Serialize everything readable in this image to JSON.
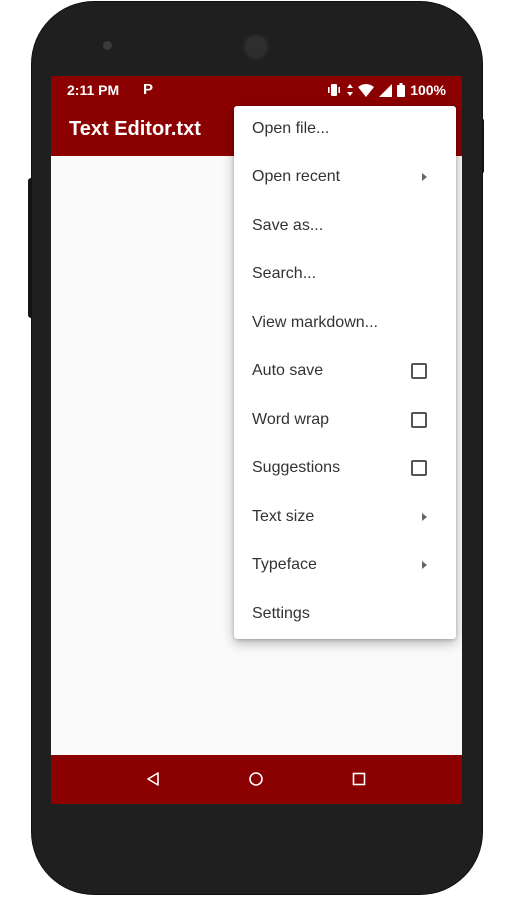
{
  "status_bar": {
    "time": "2:11 PM",
    "notification_glyph": "P",
    "battery": "100%",
    "icons": [
      "vibrate-icon",
      "data-arrows-icon",
      "wifi-icon",
      "cell-signal-icon",
      "battery-icon"
    ]
  },
  "app_bar": {
    "title": "Text Editor.txt"
  },
  "colors": {
    "accent": "#8b0000",
    "background": "#fafafa",
    "menu_text": "#333333"
  },
  "menu": {
    "items": [
      {
        "label": "Open file...",
        "type": "action"
      },
      {
        "label": "Open recent",
        "type": "submenu"
      },
      {
        "label": "Save as...",
        "type": "action"
      },
      {
        "label": "Search...",
        "type": "action"
      },
      {
        "label": "View markdown...",
        "type": "action"
      },
      {
        "label": "Auto save",
        "type": "checkbox",
        "checked": false
      },
      {
        "label": "Word wrap",
        "type": "checkbox",
        "checked": false
      },
      {
        "label": "Suggestions",
        "type": "checkbox",
        "checked": false
      },
      {
        "label": "Text size",
        "type": "submenu"
      },
      {
        "label": "Typeface",
        "type": "submenu"
      },
      {
        "label": "Settings",
        "type": "action"
      }
    ]
  },
  "nav_bar": {
    "buttons": [
      "back-icon",
      "home-icon",
      "recents-icon"
    ]
  }
}
